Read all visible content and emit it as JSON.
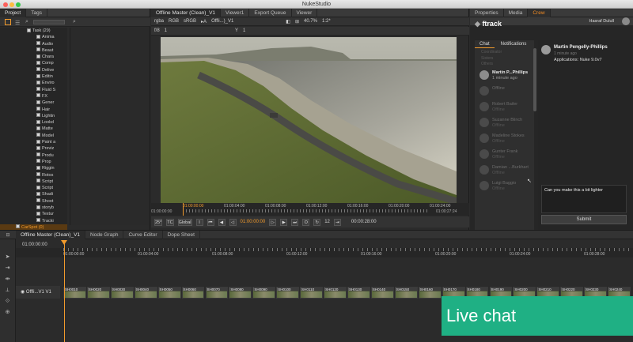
{
  "window": {
    "title": "NukeStudio"
  },
  "left": {
    "tabs": [
      "Project",
      "Tags"
    ],
    "tree": {
      "root": "Task (29)",
      "items": [
        "Anima",
        "Audio",
        "Beaut",
        "Chara",
        "Comp",
        "Delive",
        "Editin",
        "Enviro",
        "Fluid S",
        "FX",
        "Gener",
        "Hair",
        "Lightin",
        "Lookd",
        "Matte",
        "Model",
        "Paint a",
        "Previz",
        "Produ",
        "Prop",
        "Riggin",
        "Rotos",
        "Script",
        "Script",
        "Shadi",
        "Shoot",
        "storyb",
        "Textur",
        "Tracki"
      ],
      "selected": "CarSpot (0)"
    }
  },
  "viewer": {
    "tabs": [
      "Offline Master (Clean)_V1",
      "Viewer1",
      "Export Queue",
      "Viewer"
    ],
    "toolbar": {
      "color_channel": "rgba",
      "colorspace1": "RGB",
      "colorspace2": "sRGB",
      "clip": "Offli...)_V1",
      "zoom": "40.7%",
      "ratio": "1:2*"
    },
    "toolbar2": {
      "fstop": "f/8",
      "value1": "1",
      "y_label": "Y",
      "y_value": "1"
    },
    "transport": {
      "frame_rate": "25*",
      "tc": "TC",
      "global": "Global",
      "current": "01:00:00:00",
      "step": "12",
      "in": "01:00:00:00",
      "out": "01:00:27:24",
      "duration": "00:00:28:00"
    },
    "ruler_ticks": [
      "01:00:00:00",
      "01:00:04:00",
      "01:00:08:00",
      "01:00:12:00",
      "01:00:16:00",
      "01:00:20:00",
      "01:00:24:00"
    ],
    "playhead_label": "01:00:00:00"
  },
  "right": {
    "tabs": [
      "Properties",
      "Media",
      "Crew"
    ],
    "user": "Hasraf Dulull",
    "logo": "ftrack",
    "chat_tabs": [
      "Chat",
      "Notifications"
    ],
    "top_labels": [
      "Coordinator",
      "Sisters",
      "Others"
    ],
    "users": [
      {
        "name": "Martin P...Phillips",
        "status": "1 minute ago",
        "online": true
      },
      {
        "name": "Offline",
        "status": "",
        "online": false
      },
      {
        "name": "Robert Bailer",
        "status": "Offline",
        "online": false
      },
      {
        "name": "Suzanne Blinch",
        "status": "Offline",
        "online": false
      },
      {
        "name": "Madeline Stokes",
        "status": "Offline",
        "online": false
      },
      {
        "name": "Gunter Frank",
        "status": "Offline",
        "online": false
      },
      {
        "name": "Damian ...Burkhart",
        "status": "Offline",
        "online": false
      },
      {
        "name": "Luigi Baggio",
        "status": "Offline",
        "online": false
      }
    ],
    "message": {
      "author": "Martin Pengelly-Phillips",
      "time": "1 minute ago",
      "text": "Applications: Nuke 9.0v7"
    },
    "input_text": "Can you make this a bit lighter",
    "submit_label": "Submit"
  },
  "timeline": {
    "tabs": [
      "Offline Master (Clean)_V1",
      "Node Graph",
      "Curve Editor",
      "Dope Sheet"
    ],
    "timecode": "01:00:00:00",
    "ticks": [
      "01:00:00:00",
      "01:00:04:00",
      "01:00:08:00",
      "01:00:12:00",
      "01:00:16:00",
      "01:00:20:00",
      "01:00:24:00",
      "01:00:28:00"
    ],
    "track_name": "Offli...V1 V1",
    "clips": [
      "SH0010",
      "SH0020",
      "SH0030",
      "SH0040",
      "SH0050",
      "SH0060",
      "SH0070",
      "SH0080",
      "SH0090",
      "SH0100",
      "SH0110",
      "SH0120",
      "SH0130",
      "SH0140",
      "SH0150",
      "SH0160",
      "SH0170",
      "SH0180",
      "SH0190",
      "SH0200",
      "SH0210",
      "SH0220",
      "SH0230",
      "SH0240"
    ]
  },
  "overlay": {
    "live_chat": "Live chat"
  }
}
